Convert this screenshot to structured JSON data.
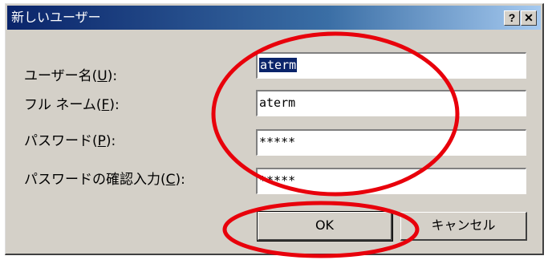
{
  "dialog": {
    "title": "新しいユーザー",
    "help_button": "?",
    "close_button": "✕"
  },
  "fields": [
    {
      "label": "ユーザー名(",
      "mnemonic": "U",
      "suffix": "):",
      "value": "aterm",
      "selected": true
    },
    {
      "label": "フル ネーム(",
      "mnemonic": "F",
      "suffix": "):",
      "value": "aterm",
      "selected": false
    },
    {
      "label": "パスワード(",
      "mnemonic": "P",
      "suffix": "):",
      "value": "*****",
      "selected": false
    },
    {
      "label": "パスワードの確認入力(",
      "mnemonic": "C",
      "suffix": "):",
      "value": "*****",
      "selected": false
    }
  ],
  "buttons": {
    "ok": "OK",
    "cancel": "キャンセル"
  },
  "colors": {
    "annotation": "#e8000b",
    "titlebar_start": "#0a246a",
    "dialog_bg": "#d4d0c8"
  }
}
